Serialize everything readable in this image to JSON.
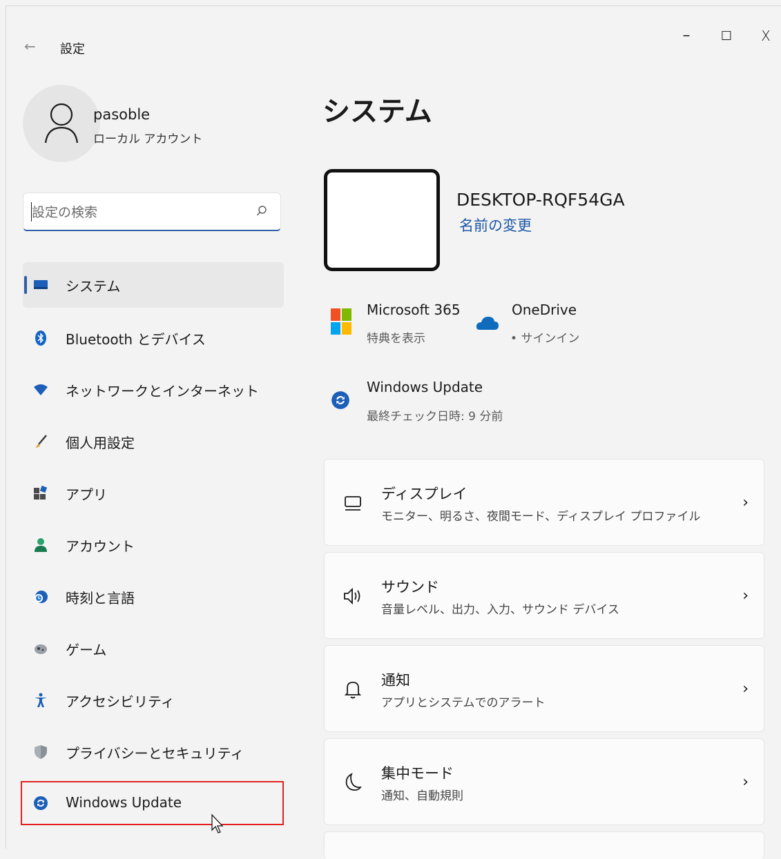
{
  "titlebar": {
    "back": "←",
    "title": "設定",
    "minimize": "–",
    "maximize": "☐",
    "close": "X"
  },
  "profile": {
    "name": "pasoble",
    "account_type": "ローカル アカウント"
  },
  "search": {
    "placeholder": "設定の検索"
  },
  "nav": {
    "items": [
      {
        "label": "システム",
        "icon": "system-icon",
        "selected": true
      },
      {
        "label": "Bluetooth とデバイス",
        "icon": "bluetooth-icon"
      },
      {
        "label": "ネットワークとインターネット",
        "icon": "wifi-icon"
      },
      {
        "label": "個人用設定",
        "icon": "brush-icon"
      },
      {
        "label": "アプリ",
        "icon": "apps-icon"
      },
      {
        "label": "アカウント",
        "icon": "account-icon"
      },
      {
        "label": "時刻と言語",
        "icon": "time-language-icon"
      },
      {
        "label": "ゲーム",
        "icon": "gaming-icon"
      },
      {
        "label": "アクセシビリティ",
        "icon": "accessibility-icon"
      },
      {
        "label": "プライバシーとセキュリティ",
        "icon": "shield-icon"
      },
      {
        "label": "Windows Update",
        "icon": "windows-update-icon"
      }
    ]
  },
  "main": {
    "title": "システム",
    "device_name": "DESKTOP-RQF54GA",
    "rename_link": "名前の変更",
    "tiles": {
      "m365_title": "Microsoft 365",
      "m365_sub": "特典を表示",
      "onedrive_title": "OneDrive",
      "onedrive_sub": "• サインイン",
      "update_title": "Windows Update",
      "update_sub": "最終チェック日時: 9 分前"
    },
    "cards": [
      {
        "title": "ディスプレイ",
        "sub": "モニター、明るさ、夜間モード、ディスプレイ プロファイル",
        "icon": "display-icon"
      },
      {
        "title": "サウンド",
        "sub": "音量レベル、出力、入力、サウンド デバイス",
        "icon": "sound-icon"
      },
      {
        "title": "通知",
        "sub": "アプリとシステムでのアラート",
        "icon": "bell-icon"
      },
      {
        "title": "集中モード",
        "sub": "通知、自動規則",
        "icon": "moon-icon"
      }
    ],
    "chevron": "›"
  },
  "colors": {
    "accent": "#2e5ea8",
    "highlight_border": "#e0201e",
    "background": "#f3f3f3"
  }
}
